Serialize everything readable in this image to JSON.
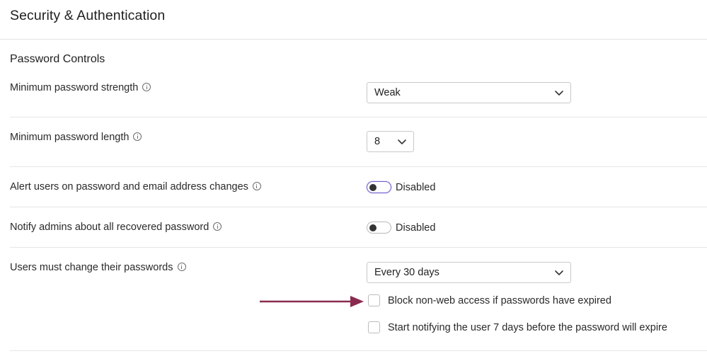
{
  "header": {
    "title": "Security & Authentication"
  },
  "section": {
    "title": "Password Controls"
  },
  "rows": [
    {
      "label": "Minimum password strength",
      "control": "select",
      "value": "Weak"
    },
    {
      "label": "Minimum password length",
      "control": "select",
      "value": "8"
    },
    {
      "label": "Alert users on password and email address changes",
      "control": "toggle",
      "value": "Disabled",
      "on": false,
      "focused": true
    },
    {
      "label": "Notify admins about all recovered password",
      "control": "toggle",
      "value": "Disabled",
      "on": false
    },
    {
      "label": "Users must change their passwords",
      "control": "select",
      "value": "Every 30 days"
    }
  ],
  "checkboxes": [
    {
      "label": "Block non-web access if passwords have expired",
      "checked": false
    },
    {
      "label": "Start notifying the user 7 days before the password will expire",
      "checked": false
    }
  ],
  "icons": {
    "info": "info-circle-icon",
    "chevron": "chevron-down-icon",
    "arrow": "arrow-right-icon"
  },
  "colors": {
    "arrow": "#8a2a4f",
    "toggle_focus": "#6d5bd0",
    "divider": "#e6e6e6"
  }
}
